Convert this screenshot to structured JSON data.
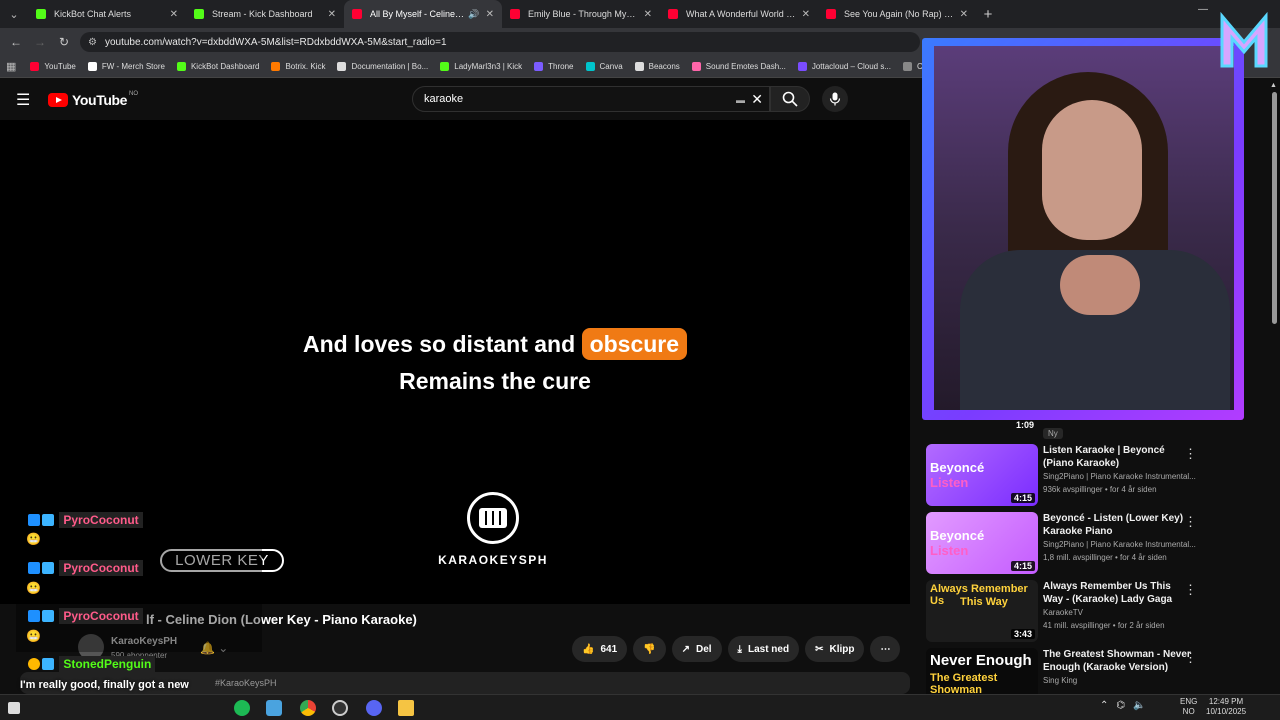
{
  "browser": {
    "tabs": [
      {
        "title": "KickBot Chat Alerts",
        "color": "#53fc18"
      },
      {
        "title": "Stream - Kick Dashboard",
        "color": "#53fc18"
      },
      {
        "title": "All By Myself - Celine Dion",
        "color": "#ff0033",
        "active": true
      },
      {
        "title": "Emily Blue - Through My Soul",
        "color": "#ff0033"
      },
      {
        "title": "What A Wonderful World - Lou",
        "color": "#ff0033"
      },
      {
        "title": "See You Again (No Rap) - Char",
        "color": "#ff0033"
      }
    ],
    "url": "youtube.com/watch?v=dxbddWXA-5M&list=RDdxbddWXA-5M&start_radio=1",
    "bookmarks": [
      {
        "label": "YouTube",
        "color": "#ff0033"
      },
      {
        "label": "FW - Merch Store",
        "color": "#ffffff"
      },
      {
        "label": "KickBot Dashboard",
        "color": "#53fc18"
      },
      {
        "label": "Botrix. Kick",
        "color": "#ff7a00"
      },
      {
        "label": "Documentation | Bo...",
        "color": "#dddddd"
      },
      {
        "label": "LadyMarl3n3 | Kick",
        "color": "#53fc18"
      },
      {
        "label": "Throne",
        "color": "#7b5cff"
      },
      {
        "label": "Canva",
        "color": "#00c4cc"
      },
      {
        "label": "Beacons",
        "color": "#dddddd"
      },
      {
        "label": "Sound Emotes Dash...",
        "color": "#ff66aa"
      },
      {
        "label": "Jottacloud – Cloud s...",
        "color": "#7a4cff"
      },
      {
        "label": "Cont",
        "color": "#888888"
      }
    ]
  },
  "youtube": {
    "logo_text": "YouTube",
    "country": "NO",
    "search_value": "karaoke"
  },
  "video": {
    "lyric_line1_before": "And loves so distant and",
    "lyric_highlight": "obscure",
    "lyric_line2": "Remains the cure",
    "badge": "LOWER KEY",
    "brand_text": "KARAOKEYSPH",
    "title": "lf - Celine Dion (Lower Key - Piano Karaoke)",
    "channel": "KaraoKeysPH",
    "subscribers": "590 abonnenter",
    "likes": "641",
    "share_label": "Del",
    "download_label": "Last ned",
    "clip_label": "Klipp",
    "hashtag": "#KaraoKeysPH"
  },
  "sidebar": {
    "current_duration": "1:09",
    "new_badge": "Ny",
    "items": [
      {
        "title": "Listen Karaoke | Beyoncé (Piano Karaoke)",
        "channel": "Sing2Piano | Piano Karaoke Instrumental...",
        "views": "936k avspillinger • for 4 år siden",
        "duration": "4:15",
        "thumb_top": "Beyoncé",
        "thumb_bottom": "Listen",
        "thumb_color": "#9b3cff"
      },
      {
        "title": "Beyoncé - Listen (Lower Key) Karaoke Piano",
        "channel": "Sing2Piano | Piano Karaoke Instrumental...",
        "views": "1,8 mill. avspillinger • for 4 år siden",
        "duration": "4:15",
        "thumb_top": "Beyoncé",
        "thumb_bottom": "Listen",
        "thumb_color": "#c45cff"
      },
      {
        "title": "Always Remember Us This Way - (Karaoke) Lady Gaga",
        "channel": "KaraokeTV",
        "views": "41 mill. avspillinger • for 2 år siden",
        "duration": "3:43",
        "thumb_top": "Always Remember Us",
        "thumb_bottom": "This Way",
        "thumb_color": "#2a2a2a"
      },
      {
        "title": "The Greatest Showman - Never Enough (Karaoke Version)",
        "channel": "Sing King",
        "views": "",
        "duration": "",
        "thumb_top": "Never Enough",
        "thumb_bottom": "The Greatest Showman",
        "thumb_color": "#111111"
      }
    ]
  },
  "chat": {
    "messages": [
      {
        "user": "PyroCoconut",
        "color": "#ff5b8a"
      },
      {
        "user": "PyroCoconut",
        "color": "#ff5b8a"
      },
      {
        "user": "PyroCoconut",
        "color": "#ff5b8a"
      },
      {
        "user": "StonedPenguin",
        "color": "#53fc18"
      }
    ],
    "last_message": "I'm really good, finally got a new headset and mouse"
  },
  "taskbar": {
    "lang_top": "ENG",
    "lang_bottom": "NO",
    "time": "12:49 PM",
    "date": "10/10/2025"
  }
}
